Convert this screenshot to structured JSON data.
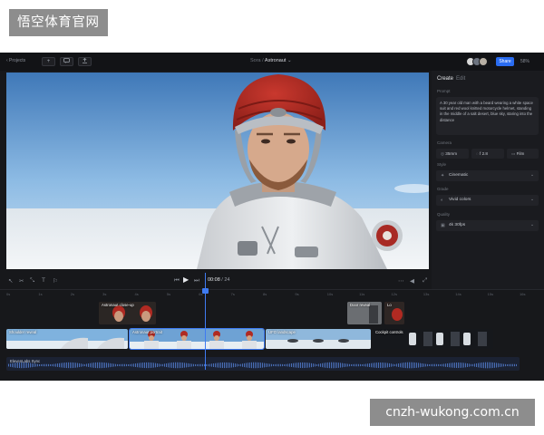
{
  "watermark_top": "悟空体育官网",
  "watermark_bottom": "cnzh-wukong.com.cn",
  "topbar": {
    "back_label": "‹  Projects",
    "breadcrumb_parent": "Sora",
    "breadcrumb_separator": " / ",
    "breadcrumb_current": "Astronaut",
    "share_label": "Share",
    "zoom": "58%",
    "avatar_colors": [
      "#d9d9d9",
      "#6d7480",
      "#b8b0a4"
    ]
  },
  "panel": {
    "tabs": [
      "Create",
      "Edit"
    ],
    "prompt_label": "Prompt",
    "prompt_text": "A 30 year old man with a beard wearing a white space suit and red wool knitted motorcycle helmet, standing in the middle of a salt desert, blue sky, staring into the distance",
    "camera_label": "Camera",
    "camera_options": [
      {
        "value": "35mm",
        "icon": "lens-icon"
      },
      {
        "value": "f 2.8",
        "icon": "aperture-icon"
      },
      {
        "value": "Film",
        "icon": "film-icon"
      }
    ],
    "style_label": "Style",
    "style_value": "Cinematic",
    "grade_label": "Grade",
    "grade_value": "Vivid colors",
    "quality_label": "Quality",
    "quality_value": "4k 30fps"
  },
  "player": {
    "current_time": "00:08",
    "total_time": "24"
  },
  "timeline": {
    "ticks": [
      "0s",
      "1s",
      "2s",
      "3s",
      "4s",
      "5s",
      "6s",
      "7s",
      "8s",
      "9s",
      "10s",
      "11s",
      "12s",
      "13s",
      "14s",
      "15s",
      "16s"
    ],
    "clips_top": [
      "Astronaut close-up",
      "Door reveal",
      "Lo"
    ],
    "clips_main": [
      "Shoulder reveal",
      "Astronaut portrait",
      "UFO landscape",
      "Cockpit controls"
    ],
    "audio_label": "ElevenLabs Sync"
  },
  "colors": {
    "app_bg": "#17181b",
    "panel_bg": "#1a1b1f",
    "accent": "#2a6cf0",
    "playhead": "#3f7bf2",
    "helmet_red": "#b02a22",
    "sky_top": "#3f78b8",
    "watermark_bg": "#8d8d8d"
  }
}
